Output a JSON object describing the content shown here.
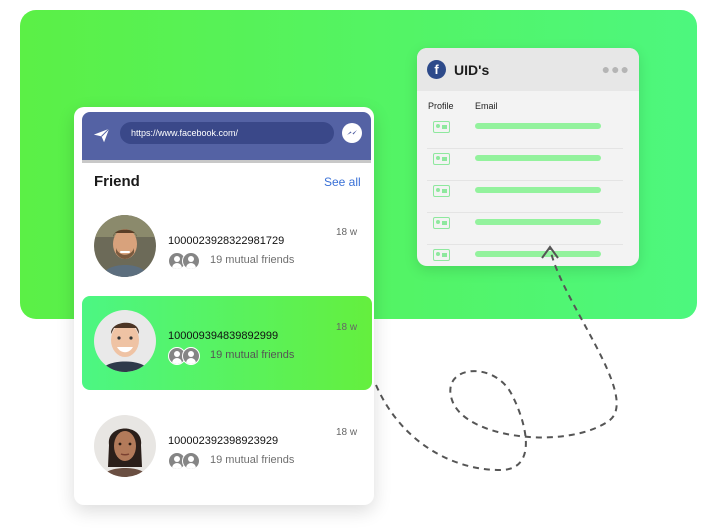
{
  "uid_card": {
    "title": "UID's",
    "col_profile": "Profile",
    "col_email": "Email",
    "rows": 5,
    "accent": "#93f29d"
  },
  "friend_card": {
    "url": "https://www.facebook.com/",
    "heading": "Friend",
    "see_all": "See all",
    "friends": [
      {
        "uid": "1000023928322981729",
        "age": "18 w",
        "mutual": "19 mutual friends"
      },
      {
        "uid": "100009394839892999",
        "age": "18 w",
        "mutual": "19 mutual friends"
      },
      {
        "uid": "100002392398923929",
        "age": "18 w",
        "mutual": "19 mutual friends"
      }
    ]
  },
  "icons": [
    "facebook-icon",
    "more-icon",
    "id-card-icon",
    "send-icon",
    "messenger-icon",
    "user-icon"
  ],
  "colors": {
    "brand": "#5462a4",
    "green": "#4df77e",
    "link": "#3970d6"
  }
}
